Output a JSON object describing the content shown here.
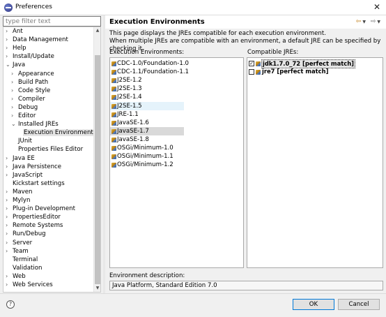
{
  "window": {
    "title": "Preferences",
    "close_glyph": "✕"
  },
  "filter": {
    "placeholder": "type filter text"
  },
  "tree": [
    {
      "label": "Ant",
      "level": 0,
      "arrow": ">"
    },
    {
      "label": "Data Management",
      "level": 0,
      "arrow": ">"
    },
    {
      "label": "Help",
      "level": 0,
      "arrow": ">"
    },
    {
      "label": "Install/Update",
      "level": 0,
      "arrow": ">"
    },
    {
      "label": "Java",
      "level": 0,
      "arrow": "v"
    },
    {
      "label": "Appearance",
      "level": 1,
      "arrow": ">"
    },
    {
      "label": "Build Path",
      "level": 1,
      "arrow": ">"
    },
    {
      "label": "Code Style",
      "level": 1,
      "arrow": ">"
    },
    {
      "label": "Compiler",
      "level": 1,
      "arrow": ">"
    },
    {
      "label": "Debug",
      "level": 1,
      "arrow": ">"
    },
    {
      "label": "Editor",
      "level": 1,
      "arrow": ">"
    },
    {
      "label": "Installed JREs",
      "level": 1,
      "arrow": "v"
    },
    {
      "label": "Execution Environments",
      "level": 2,
      "arrow": "",
      "selected": true
    },
    {
      "label": "JUnit",
      "level": 1,
      "arrow": ""
    },
    {
      "label": "Properties Files Editor",
      "level": 1,
      "arrow": ""
    },
    {
      "label": "Java EE",
      "level": 0,
      "arrow": ">"
    },
    {
      "label": "Java Persistence",
      "level": 0,
      "arrow": ">"
    },
    {
      "label": "JavaScript",
      "level": 0,
      "arrow": ">"
    },
    {
      "label": "Kickstart settings",
      "level": 0,
      "arrow": ""
    },
    {
      "label": "Maven",
      "level": 0,
      "arrow": ">"
    },
    {
      "label": "Mylyn",
      "level": 0,
      "arrow": ">"
    },
    {
      "label": "Plug-in Development",
      "level": 0,
      "arrow": ">"
    },
    {
      "label": "PropertiesEditor",
      "level": 0,
      "arrow": ">"
    },
    {
      "label": "Remote Systems",
      "level": 0,
      "arrow": ">"
    },
    {
      "label": "Run/Debug",
      "level": 0,
      "arrow": ">"
    },
    {
      "label": "Server",
      "level": 0,
      "arrow": ">"
    },
    {
      "label": "Team",
      "level": 0,
      "arrow": ">"
    },
    {
      "label": "Terminal",
      "level": 0,
      "arrow": ""
    },
    {
      "label": "Validation",
      "level": 0,
      "arrow": ""
    },
    {
      "label": "Web",
      "level": 0,
      "arrow": ">"
    },
    {
      "label": "Web Services",
      "level": 0,
      "arrow": ">"
    }
  ],
  "page": {
    "title": "Execution Environments",
    "description_line1": "This page displays the JREs compatible for each execution environment.",
    "description_line2": "When multiple JREs are compatible with an environment, a default JRE can be specified by checking it.",
    "env_label": "Execution Environments:",
    "jre_label": "Compatible JREs:",
    "env_desc_label": "Environment description:",
    "env_desc_value": "Java Platform, Standard Edition 7.0"
  },
  "environments": [
    {
      "label": "CDC-1.0/Foundation-1.0"
    },
    {
      "label": "CDC-1.1/Foundation-1.1"
    },
    {
      "label": "J2SE-1.2"
    },
    {
      "label": "J2SE-1.3"
    },
    {
      "label": "J2SE-1.4"
    },
    {
      "label": "J2SE-1.5",
      "hover": true
    },
    {
      "label": "JRE-1.1"
    },
    {
      "label": "JavaSE-1.6"
    },
    {
      "label": "JavaSE-1.7",
      "selected": true
    },
    {
      "label": "JavaSE-1.8"
    },
    {
      "label": "OSGi/Minimum-1.0"
    },
    {
      "label": "OSGi/Minimum-1.1"
    },
    {
      "label": "OSGi/Minimum-1.2"
    }
  ],
  "jres": [
    {
      "label": "jdk1.7.0_72 [perfect match]",
      "checked": true,
      "selected": true
    },
    {
      "label": "jre7 [perfect match]",
      "checked": false
    }
  ],
  "buttons": {
    "ok": "OK",
    "cancel": "Cancel",
    "help": "?"
  },
  "nav": {
    "back": "⇦",
    "forward": "⇨",
    "dropdown": "▼"
  },
  "colors": {
    "selection": "#d9d9d9",
    "hover": "#e5f3fb",
    "accent": "#0078d7"
  }
}
